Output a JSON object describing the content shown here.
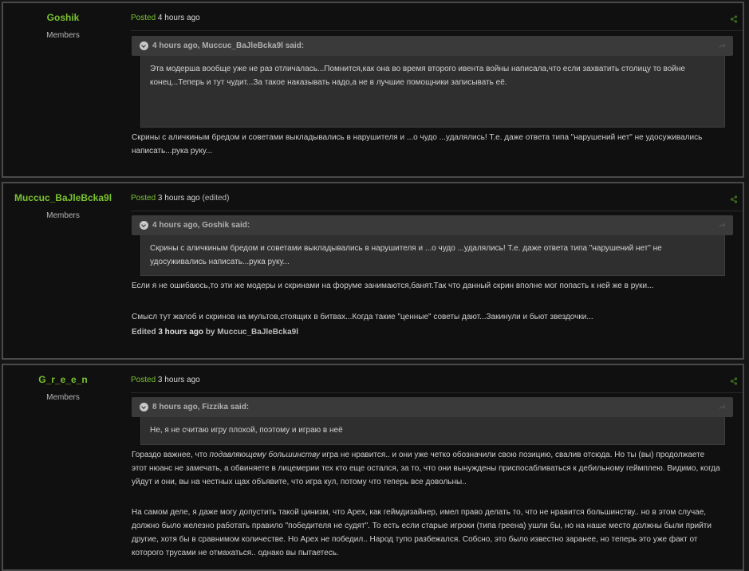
{
  "posts": [
    {
      "author": "Goshik",
      "group": "Members",
      "posted_label": "Posted",
      "time": "4 hours ago",
      "edited": "",
      "quote": {
        "title": "4 hours ago, Muccuc_BaJleBcka9l said:",
        "text": "Эта модерша вообще уже не раз отличалась...Помнится,как она во время второго ивента войны написала,что если захватить столицу то войне конец...Теперь и тут чудит...За такое наказывать надо,а не в лучшие помощники записывать её."
      },
      "body": [
        "Скрины с аличкиным бредом и советами выкладывались в нарушителя и ...о чудо ...удалялись! Т.е. даже ответа типа \"нарушений нет\" не удосуживались написать...рука руку..."
      ]
    },
    {
      "author": "Muccuc_BaJleBcka9l",
      "group": "Members",
      "posted_label": "Posted",
      "time": "3 hours ago",
      "edited": "(edited)",
      "quote": {
        "title": "4 hours ago, Goshik said:",
        "text": "Скрины с аличкиным бредом и советами выкладывались в нарушителя и ...о чудо ...удалялись! Т.е. даже ответа типа \"нарушений нет\" не удосуживались написать...рука руку..."
      },
      "body": [
        "Если я не ошибаюсь,то эти же модеры и скринами на форуме занимаются,банят.Так что данный скрин вполне мог попасть к ней же в руки...",
        "Смысл тут жалоб и скринов на мультов,стоящих в битвах...Когда такие \"ценные\" советы дают...Закинули и бьют звездочки..."
      ],
      "edit_note": {
        "prefix": "Edited",
        "time": "3 hours ago",
        "by": "by Muccuc_BaJleBcka9l"
      }
    },
    {
      "author": "G_r_e_e_n",
      "group": "Members",
      "posted_label": "Posted",
      "time": "3 hours ago",
      "edited": "",
      "quote": {
        "title": "8 hours ago, Fizzika said:",
        "text": "Не, я не считаю игру плохой, поэтому и играю в неё"
      },
      "body_p1": {
        "a": "Гораздо важнее, что ",
        "em": "подавляющему большинству",
        "b": " игра не нравится.. и они уже четко обозначили свою позицию, свалив отсюда. Но ты (вы) продолжаете этот нюанс не замечать, а обвиняете в лицемерии тех кто еще остался, за то, что они вынуждены приспосабливаться к дебильному геймплею. Видимо, когда уйдут и они, вы на честных щах объявите, что игра кул, потому что теперь все довольны.."
      },
      "body_p2": "На самом деле, я даже могу допустить такой цинизм, что Apex, как геймдизайнер, имел право делать то, что не нравится большинству.. но в этом случае, должно было железно работать правило \"победителя не судят\". То есть если старые игроки (типа греена) ушли бы, но на наше место должны были прийти другие, хотя бы в сравнимом количестве. Но Apex не победил.. Народ тупо разбежался. Собсно, это было известно заранее, но теперь это уже факт от которого трусами не отмахаться.. однако вы пытаетесь."
    }
  ],
  "colors": {
    "accent_green": "#7ac231",
    "post_bg": "#101010",
    "quote_head_bg": "#3a3a3a",
    "quote_body_bg": "#2f2f2f"
  },
  "icons": {
    "share": "share-icon",
    "quote_toggle": "chevron-down-icon",
    "quote_link": "share-icon"
  }
}
